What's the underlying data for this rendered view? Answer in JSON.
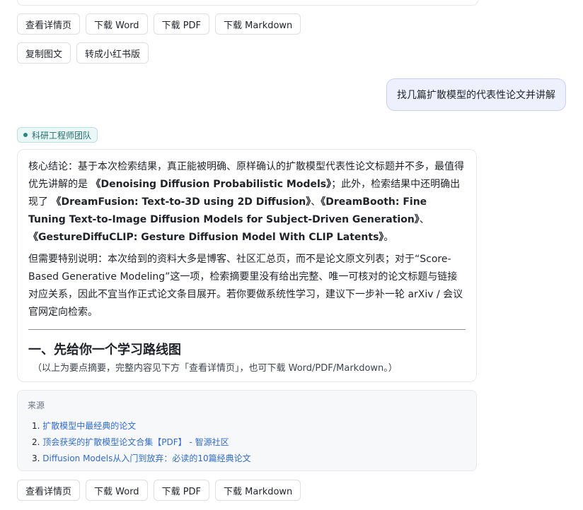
{
  "toolbar_top": {
    "row1": [
      "查看详情页",
      "下载 Word",
      "下载 PDF",
      "下载 Markdown"
    ],
    "row2": [
      "复制图文",
      "转成小红书版"
    ]
  },
  "user_message": "找几篇扩散模型的代表性论文并讲解",
  "agent": {
    "name": "科研工程师团队"
  },
  "answer": {
    "p1_prefix": "核心结论：基于本次检索结果，真正能被明确、原样确认的扩散模型代表性论文标题并不多，最值得优先讲解的是",
    "p1_title1": "《Denoising Diffusion Probabilistic Models》",
    "p1_mid": "；此外，检索结果中还明确出现了",
    "p1_title2": "《DreamFusion: Text-to-3D using 2D Diffusion》",
    "p1_sep1": "、",
    "p1_title3": "《DreamBooth: Fine Tuning Text-to-Image Diffusion Models for Subject-Driven Generation》",
    "p1_sep2": "、",
    "p1_title4": "《GestureDiffuCLIP: Gesture Diffusion Model With CLIP Latents》",
    "p1_end": "。",
    "p2": "但需要特别说明：本次给到的资料大多是博客、社区汇总页，而不是论文原文列表；对于“Score-Based Generative Modeling”这一项，检索摘要里没有给出完整、唯一可核对的论文标题与链接对应关系，因此不宜当作正式论文条目展开。若你要做系统性学习，建议下一步补一轮 arXiv / 会议官网定向检索。",
    "heading": "一、先给你一个学习路线图",
    "note": "（以上为要点摘要，完整内容见下方「查看详情页」，也可下载 Word/PDF/Markdown。）"
  },
  "sources": {
    "title": "来源",
    "items": [
      {
        "num": "1.",
        "text": "扩散模型中最经典的论文"
      },
      {
        "num": "2.",
        "text": "顶会获奖的扩散模型论文合集【PDF】 - 智源社区"
      },
      {
        "num": "3.",
        "text": "Diffusion Models从入门到放弃：必读的10篇经典论文"
      }
    ]
  },
  "toolbar_bottom": [
    "查看详情页",
    "下载 Word",
    "下载 PDF",
    "下载 Markdown"
  ]
}
